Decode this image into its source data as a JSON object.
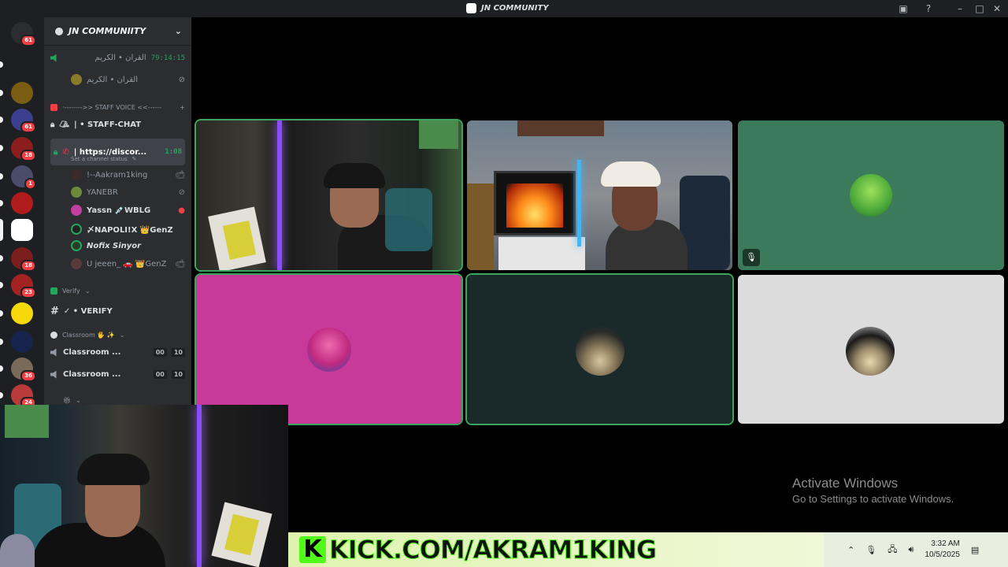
{
  "window": {
    "title": "JN COMMUNITY"
  },
  "rail": {
    "servers": [
      {
        "name": "direct-messages",
        "badge": "61",
        "color": "#2b2d31"
      },
      {
        "name": "ak-server",
        "badge": "",
        "color": "#1e1f22"
      },
      {
        "name": "bg-server",
        "badge": "",
        "color": "#7a5c13"
      },
      {
        "name": "server-4",
        "badge": "61",
        "color": "#3a3f8f"
      },
      {
        "name": "server-5",
        "badge": "18",
        "color": "#8b1d1d"
      },
      {
        "name": "server-6",
        "badge": "1",
        "color": "#4a4d6a"
      },
      {
        "name": "server-7",
        "badge": "",
        "color": "#b01c1c"
      },
      {
        "name": "jn-community",
        "badge": "",
        "color": "#ffffff"
      },
      {
        "name": "server-9",
        "badge": "18",
        "color": "#7a1d1d"
      },
      {
        "name": "server-10",
        "badge": "23",
        "color": "#a42222"
      },
      {
        "name": "server-11",
        "badge": "",
        "color": "#f5d90a"
      },
      {
        "name": "arizona-roleplay",
        "badge": "",
        "color": "#16244d"
      },
      {
        "name": "server-13",
        "badge": "36",
        "color": "#7a6a5a"
      },
      {
        "name": "server-14",
        "badge": "24",
        "color": "#b83a3a"
      }
    ]
  },
  "sidebar": {
    "guild_name": "JN COMMUNIITY",
    "quran_channel": "القرآن • الكريم",
    "quran_timer": "79:14:15",
    "quran_member": "القرآن • الكريم",
    "staff_category": "·-------->> STAFF VOICE <<------",
    "staff_chat": "|  • STAFF-CHAT",
    "active_channel": "| https://discor...",
    "active_timer": "1:08",
    "channel_status": "Set a channel status",
    "members": [
      {
        "name": "!--Aakram1king",
        "color": "#3a2a2a"
      },
      {
        "name": "YANEBR",
        "color": "#6d8a3a"
      },
      {
        "name": "Yassn 💉WBLG",
        "color": "#c03fa0"
      },
      {
        "name": "〆NAPOLI!X 👑GenZ",
        "color": "#202225"
      },
      {
        "name": "Nofix Sinyor",
        "color": "#2a3a2a"
      },
      {
        "name": "U jeeen_ 🚗 👑GenZ",
        "color": "#5a3a3a"
      }
    ],
    "verify_category": "Verify",
    "verify_channel": "✓ • VERIFY",
    "classroom_category": "Classroom 🖐 ✨",
    "classrooms": [
      {
        "name": "Classroom ...",
        "count": "00",
        "limit": "10"
      },
      {
        "name": "Classroom ...",
        "count": "00",
        "limit": "10"
      }
    ]
  },
  "stage": {
    "tiles": [
      {
        "name": "camera-akram",
        "bg": "#2a2a2a"
      },
      {
        "name": "camera-friend",
        "bg": "#6b7a8a"
      },
      {
        "name": "avatar-green-monster",
        "bg": "#3b7a5a"
      },
      {
        "name": "avatar-pink-character",
        "bg": "#c8399a"
      },
      {
        "name": "avatar-mask-dark",
        "bg": "#1a2a2a"
      },
      {
        "name": "avatar-mask-light",
        "bg": "#dcdcdc"
      }
    ]
  },
  "banner": {
    "logo": "K",
    "text": "KICK.COM/AKRAM1KING"
  },
  "watermark": {
    "line1": "Activate Windows",
    "line2": "Go to Settings to activate Windows."
  },
  "taskbar": {
    "time": "3:32 AM",
    "date": "10/5/2025"
  }
}
